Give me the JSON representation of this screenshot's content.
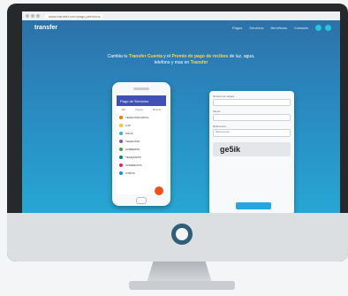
{
  "browser": {
    "url": "www.transfer.com/pago-servicios"
  },
  "nav": {
    "logo_text": "transfer",
    "links": [
      "Pagos",
      "Servicios",
      "Beneficios",
      "Contacto"
    ]
  },
  "headline": {
    "text_a": "Cambia tu",
    "highlight": "Transfer Cuenta",
    "text_b": "y el",
    "highlight2": "Premio de pago de recibos",
    "text_c": "de luz, agua, telefono y mas en",
    "brand": "Transfer"
  },
  "phone": {
    "header_title": "Pago de Servicios",
    "tabs": [
      "Mis",
      "Pagos",
      "Buscar"
    ],
    "services": [
      {
        "label": "TELEFONIA MOVIL",
        "color": "#f57c00"
      },
      {
        "label": "LUZ",
        "color": "#fbc02d"
      },
      {
        "label": "AGUA",
        "color": "#29b6f6"
      },
      {
        "label": "TELEFONO",
        "color": "#7e57c2"
      },
      {
        "label": "GOBIERNO",
        "color": "#43a047"
      },
      {
        "label": "TELEVISION",
        "color": "#00897b"
      },
      {
        "label": "COMERCIOS",
        "color": "#e91e63"
      },
      {
        "label": "OTROS",
        "color": "#1e88e5"
      }
    ]
  },
  "form": {
    "field1_label": "Numero de tarjeta",
    "field2_label": "Monto",
    "field3_label": "Referencia",
    "select_value": "Seleccionar",
    "captcha_text": "ge5ik",
    "submit_label": "Continuar"
  },
  "colors": {
    "accent": "#26a6df",
    "fab": "#f4511e"
  }
}
